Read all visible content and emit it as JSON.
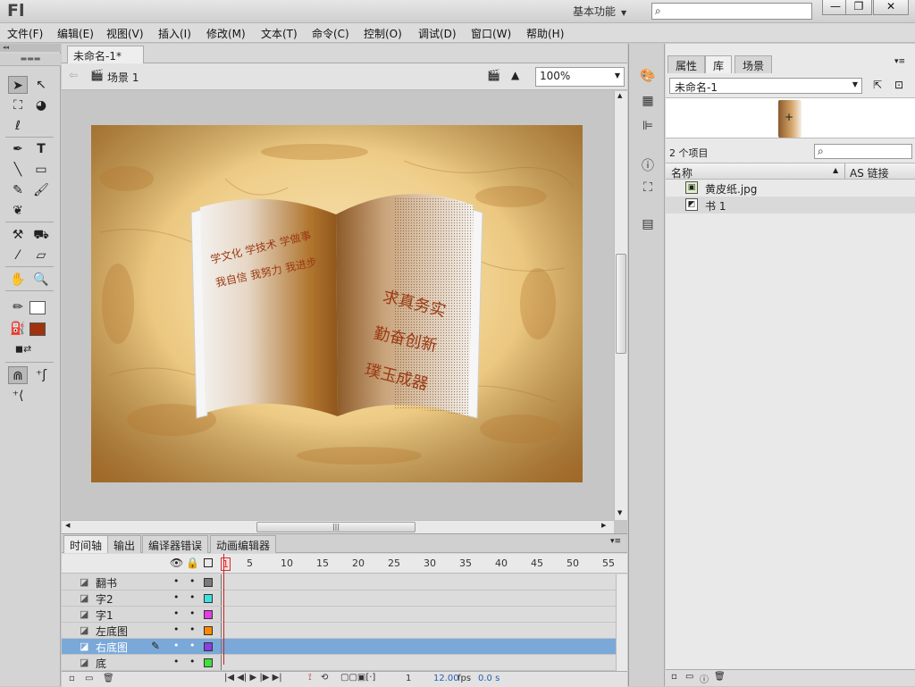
{
  "app": {
    "logo": "Fl",
    "workspace": "基本功能"
  },
  "window_controls": {
    "minimize": "—",
    "restore": "❐",
    "close": "✕"
  },
  "menu": [
    "文件(F)",
    "编辑(E)",
    "视图(V)",
    "插入(I)",
    "修改(M)",
    "文本(T)",
    "命令(C)",
    "控制(O)",
    "调试(D)",
    "窗口(W)",
    "帮助(H)"
  ],
  "document": {
    "tab": "未命名-1*",
    "scene": "场景 1",
    "zoom": "100%"
  },
  "stage_text": {
    "left_line1": "学文化  学技术  学做事",
    "left_line2": "我自信  我努力  我进步",
    "right_line1": "求真务实",
    "right_line2": "勤奋创新",
    "right_line3": "璞玉成器"
  },
  "timeline": {
    "tabs": [
      "时间轴",
      "输出",
      "编译器错误",
      "动画编辑器"
    ],
    "frame_numbers": [
      "1",
      "5",
      "10",
      "15",
      "20",
      "25",
      "30",
      "35",
      "40",
      "45",
      "50",
      "55"
    ],
    "layers": [
      {
        "name": "翻书",
        "color": "#7a7a7a"
      },
      {
        "name": "字2",
        "color": "#3fe0e0"
      },
      {
        "name": "字1",
        "color": "#e23fe2"
      },
      {
        "name": "左底图",
        "color": "#ff8a00"
      },
      {
        "name": "右底图",
        "color": "#8a3fe0"
      },
      {
        "name": "底",
        "color": "#3fe03f"
      }
    ],
    "selected_layer": "右底图",
    "current_frame": "1",
    "fps": "12.00",
    "fps_unit": "fps",
    "time": "0.0 s"
  },
  "library": {
    "tabs": [
      "属性",
      "库",
      "场景"
    ],
    "active_tab": "库",
    "document": "未命名-1",
    "count": "2 个项目",
    "col_name": "名称",
    "col_link": "AS 链接",
    "items": [
      {
        "name": "黄皮纸.jpg",
        "icon": "bitmap-icon"
      },
      {
        "name": "书 1",
        "icon": "graphic-symbol-icon"
      }
    ]
  }
}
